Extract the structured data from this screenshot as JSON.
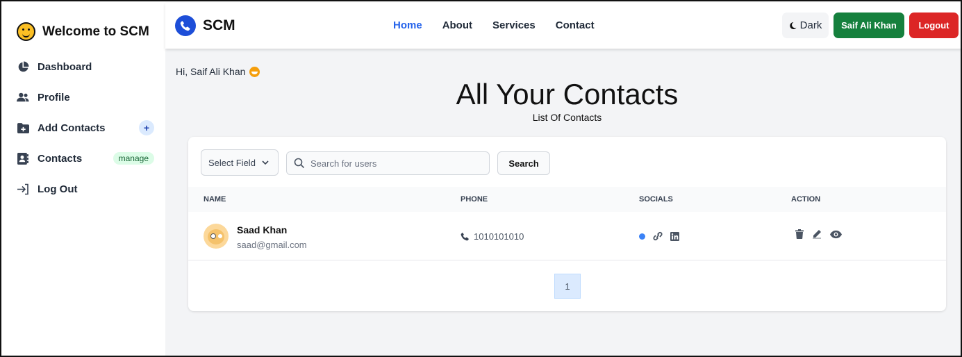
{
  "sidebar": {
    "brand": "Welcome to SCM",
    "items": [
      {
        "label": "Dashboard",
        "icon": "pie-chart-icon"
      },
      {
        "label": "Profile",
        "icon": "users-icon"
      },
      {
        "label": "Add Contacts",
        "icon": "folder-plus-icon",
        "badge": "+"
      },
      {
        "label": "Contacts",
        "icon": "address-book-icon",
        "badge": "manage"
      },
      {
        "label": "Log Out",
        "icon": "sign-out-icon"
      }
    ]
  },
  "topbar": {
    "logo": "SCM",
    "links": [
      "Home",
      "About",
      "Services",
      "Contact"
    ],
    "active_link": "Home",
    "theme_button": "Dark",
    "user_button": "Saif Ali Khan",
    "logout_button": "Logout"
  },
  "main": {
    "greeting": "Hi, Saif Ali Khan",
    "title": "All Your Contacts",
    "subtitle": "List Of Contacts",
    "filter": {
      "select_value": "Select Field",
      "search_placeholder": "Search for users",
      "search_button": "Search"
    },
    "table": {
      "headers": [
        "Name",
        "Phone",
        "Socials",
        "Action"
      ],
      "rows": [
        {
          "name": "Saad Khan",
          "email": "saad@gmail.com",
          "phone": "1010101010"
        }
      ]
    },
    "pagination": {
      "current": "1"
    }
  },
  "colors": {
    "accent": "#2563eb",
    "user_button": "#15803d",
    "logout_button": "#dc2626",
    "background": "#f3f4f6"
  }
}
